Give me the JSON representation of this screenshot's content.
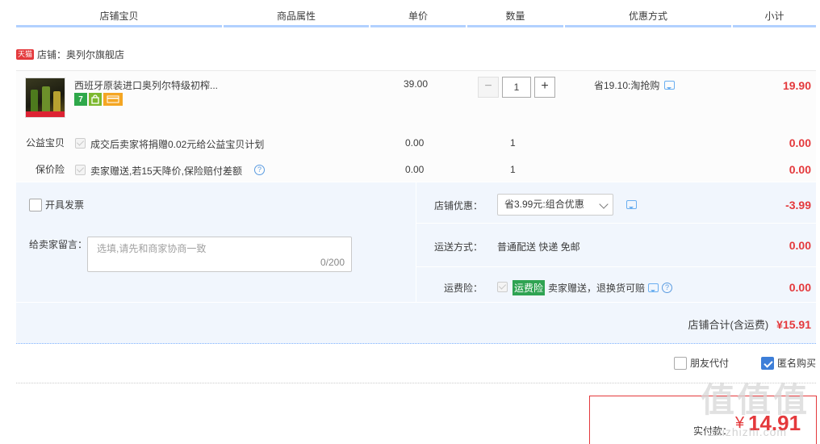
{
  "header": {
    "columns": [
      "店铺宝贝",
      "商品属性",
      "单价",
      "数量",
      "优惠方式",
      "小计"
    ]
  },
  "shop": {
    "tmall_logo": "天猫",
    "name": "店铺：奥列尔旗舰店"
  },
  "item": {
    "title": "西班牙原装进口奥列尔特级初榨...",
    "price": "39.00",
    "quantity": "1",
    "qty_minus": "−",
    "qty_plus": "+",
    "discount": "省19.10:淘抢购",
    "subtotal": "19.90",
    "badges": [
      "7",
      "bag-icon",
      "card-icon"
    ]
  },
  "services": [
    {
      "label": "公益宝贝",
      "text": "成交后卖家将捐赠0.02元给公益宝贝计划",
      "price": "0.00",
      "qty": "1",
      "subtotal": "0.00"
    },
    {
      "label": "保价险",
      "text": "卖家赠送,若15天降价,保险赔付差额",
      "price": "0.00",
      "qty": "1",
      "subtotal": "0.00"
    }
  ],
  "invoice": {
    "label": "开具发票"
  },
  "message": {
    "label": "给卖家留言：",
    "placeholder": "选填,请先和商家协商一致",
    "counter": "0/200"
  },
  "shop_discount": {
    "label": "店铺优惠：",
    "selected": "省3.99元:组合优惠",
    "value": "-3.99"
  },
  "shipping": {
    "label": "运送方式：",
    "text": "普通配送 快递 免邮",
    "value": "0.00"
  },
  "freight_insurance": {
    "label": "运费险：",
    "tag": "运费险",
    "text": "卖家赠送，退换货可赔",
    "value": "0.00"
  },
  "shop_total": {
    "label": "店铺合计(含运费)",
    "value": "¥15.91"
  },
  "options": {
    "friend_pay": "朋友代付",
    "anonymous": "匿名购买"
  },
  "payment": {
    "label": "实付款：",
    "currency": "¥",
    "amount": "14.91"
  },
  "watermark": {
    "main": "值值值",
    "sub": "zhizhizhi.com"
  },
  "colors": {
    "accent_red": "#e4393c",
    "header_blue": "#b2d1ff",
    "panel_bg": "#f1f6fd",
    "checkbox_blue": "#3d7ed8",
    "insurance_green": "#2fa352"
  }
}
